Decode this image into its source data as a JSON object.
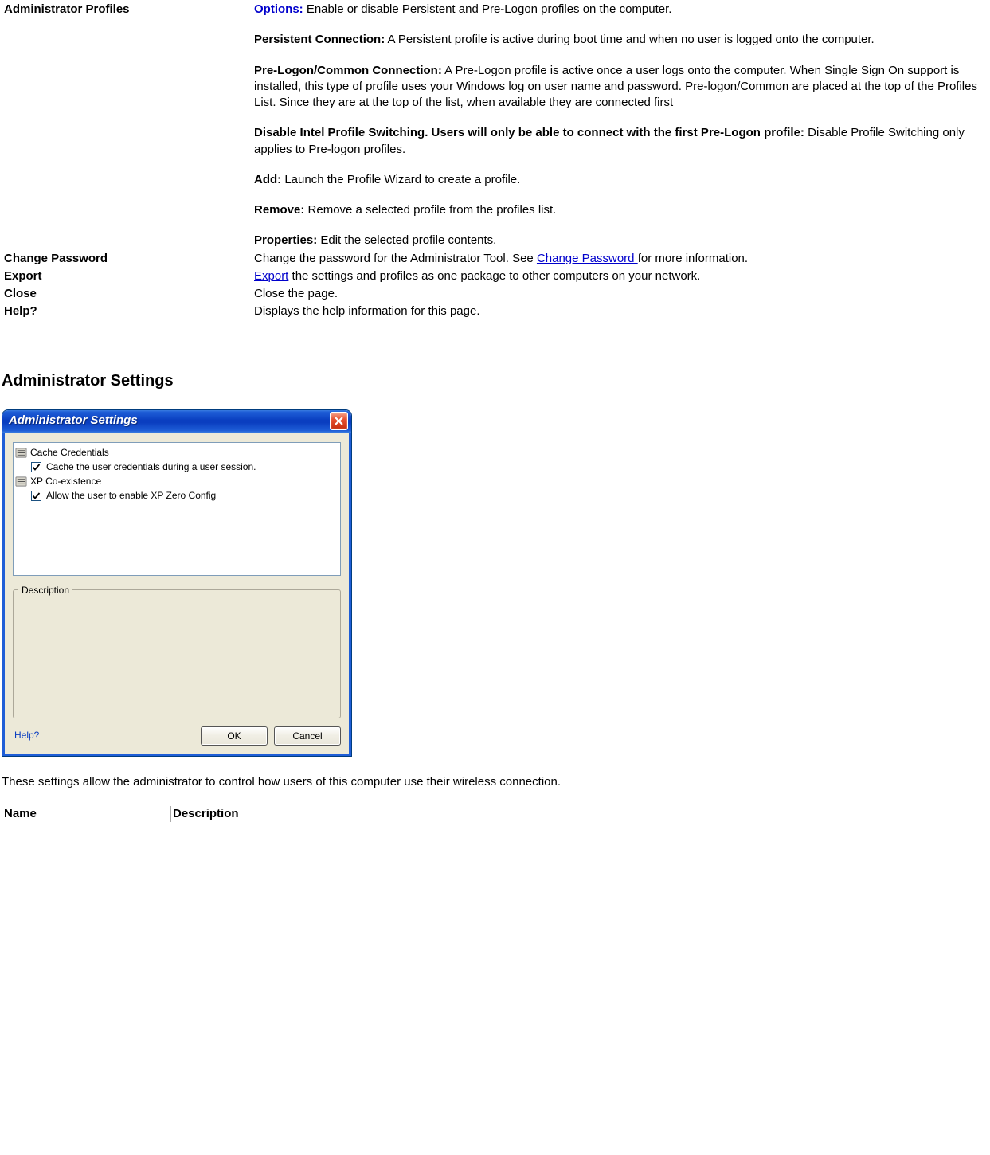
{
  "table1": {
    "rows": [
      {
        "name": "Administrator Profiles",
        "content": {
          "options_label": "Options:",
          "options_text": " Enable or disable Persistent and Pre-Logon profiles on the computer.",
          "persistent_label": "Persistent Connection:",
          "persistent_text": "  A Persistent profile is active during boot time and when no user is logged onto the computer.",
          "prelogon_label": "Pre-Logon/Common Connection:",
          "prelogon_text": " A Pre-Logon profile is active once a user logs onto the computer. When Single Sign On support is installed, this type of profile uses your Windows log on user name and password. Pre-logon/Common are placed at the top of the Profiles List. Since they are at the top of the list, when available they are connected first",
          "disable_label": "Disable Intel Profile Switching. Users will only be able to connect with the first Pre-Logon profile:",
          "disable_text": " Disable Profile Switching only applies to Pre-logon profiles.",
          "add_label": "Add:",
          "add_text": " Launch the Profile Wizard to create a profile.",
          "remove_label": "Remove:",
          "remove_text": " Remove a selected profile from the profiles list.",
          "properties_label": "Properties:",
          "properties_text": " Edit the selected profile contents."
        }
      },
      {
        "name": "Change Password",
        "text_pre": "Change the password for the Administrator Tool. See ",
        "link": "Change Password ",
        "text_post": "for more information."
      },
      {
        "name": "Export",
        "link": "Export",
        "text_post": " the settings and profiles as one package to other computers on your network."
      },
      {
        "name": "Close",
        "text": "Close the page."
      },
      {
        "name": "Help?",
        "text": "Displays the help information for this page."
      }
    ]
  },
  "section_heading": "Administrator Settings",
  "dialog": {
    "title": "Administrator Settings",
    "tree": {
      "group1": "Cache Credentials",
      "item1": "Cache the user credentials during a user session.",
      "group2": "XP Co-existence",
      "item2": "Allow the user to enable XP Zero Config"
    },
    "description_legend": "Description",
    "help": "Help?",
    "ok": "OK",
    "cancel": "Cancel"
  },
  "intro_text": "These settings allow the administrator to control how users of this computer use their wireless connection.",
  "footer": {
    "name_header": "Name",
    "desc_header": "Description"
  }
}
